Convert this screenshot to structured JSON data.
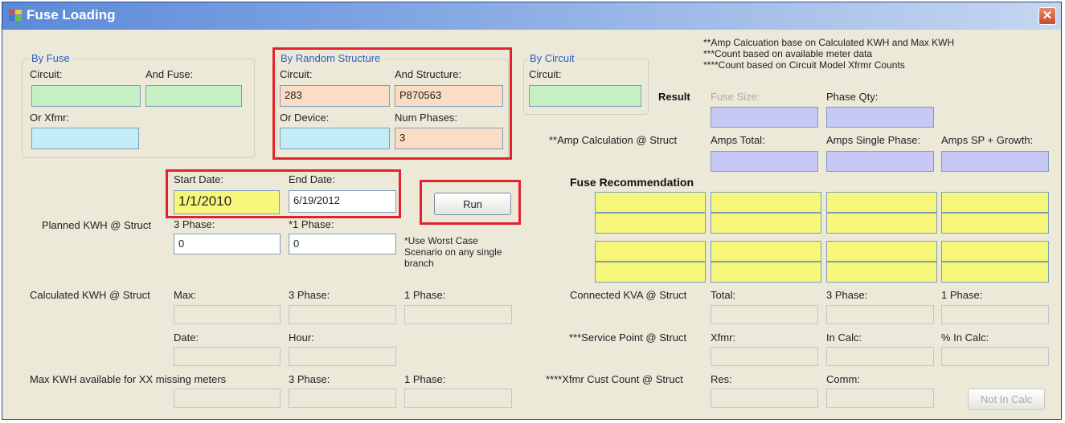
{
  "window": {
    "title": "Fuse Loading"
  },
  "notes": {
    "line1": "**Amp Calcuation base on Calculated KWH and Max KWH",
    "line2": "***Count based on available meter data",
    "line3": "****Count based on Circuit Model Xfrmr Counts"
  },
  "by_fuse": {
    "title": "By Fuse",
    "circuit_label": "Circuit:",
    "and_fuse_label": "And Fuse:",
    "or_xfmr_label": "Or Xfmr:",
    "circuit_value": "",
    "fuse_value": "",
    "xfmr_value": ""
  },
  "by_structure": {
    "title": "By Random Structure",
    "circuit_label": "Circuit:",
    "and_structure_label": "And Structure:",
    "or_device_label": "Or Device:",
    "num_phases_label": "Num Phases:",
    "circuit_value": "283",
    "structure_value": "P870563",
    "device_value": "",
    "num_phases_value": "3"
  },
  "by_circuit": {
    "title": "By Circuit",
    "circuit_label": "Circuit:",
    "circuit_value": ""
  },
  "dates": {
    "start_label": "Start Date:",
    "end_label": "End Date:",
    "start_value": "1/1/2010",
    "end_value": "6/19/2012"
  },
  "run_button": "Run",
  "planned": {
    "label": "Planned KWH @ Struct",
    "three_label": "3 Phase:",
    "one_label": "*1 Phase:",
    "three_value": "0",
    "one_value": "0",
    "note": "*Use Worst Case Scenario on any single branch"
  },
  "calculated": {
    "label": "Calculated KWH @ Struct",
    "max_label": "Max:",
    "three_label": "3 Phase:",
    "one_label": "1 Phase:",
    "date_label": "Date:",
    "hour_label": "Hour:"
  },
  "maxkwh": {
    "label": "Max KWH available for XX missing meters",
    "three_label": "3 Phase:",
    "one_label": "1 Phase:"
  },
  "result": {
    "label": "Result",
    "fuse_size_label": "Fuse Size:",
    "phase_qty_label": "Phase Qty:"
  },
  "amp_calc": {
    "label": "**Amp Calculation @ Struct",
    "total_label": "Amps Total:",
    "single_label": "Amps Single Phase:",
    "growth_label": "Amps SP + Growth:"
  },
  "fuse_rec": {
    "label": "Fuse Recommendation"
  },
  "connected": {
    "label": "Connected KVA @ Struct",
    "total_label": "Total:",
    "three_label": "3 Phase:",
    "one_label": "1 Phase:"
  },
  "service": {
    "label": "***Service Point @ Struct",
    "xfmr_label": "Xfmr:",
    "incalc_label": "In Calc:",
    "pct_label": "% In Calc:"
  },
  "xfmr_cust": {
    "label": "****Xfmr Cust Count @ Struct",
    "res_label": "Res:",
    "comm_label": "Comm:",
    "not_in_calc": "Not In Calc"
  },
  "colors": {
    "highlight_red": "#e2232a",
    "input_green": "#c6f0c4",
    "input_cyan": "#c4eef6",
    "input_peach": "#fbdcc4",
    "result_lavender": "#c8c8f6",
    "recommendation_yellow": "#f6f67a"
  }
}
